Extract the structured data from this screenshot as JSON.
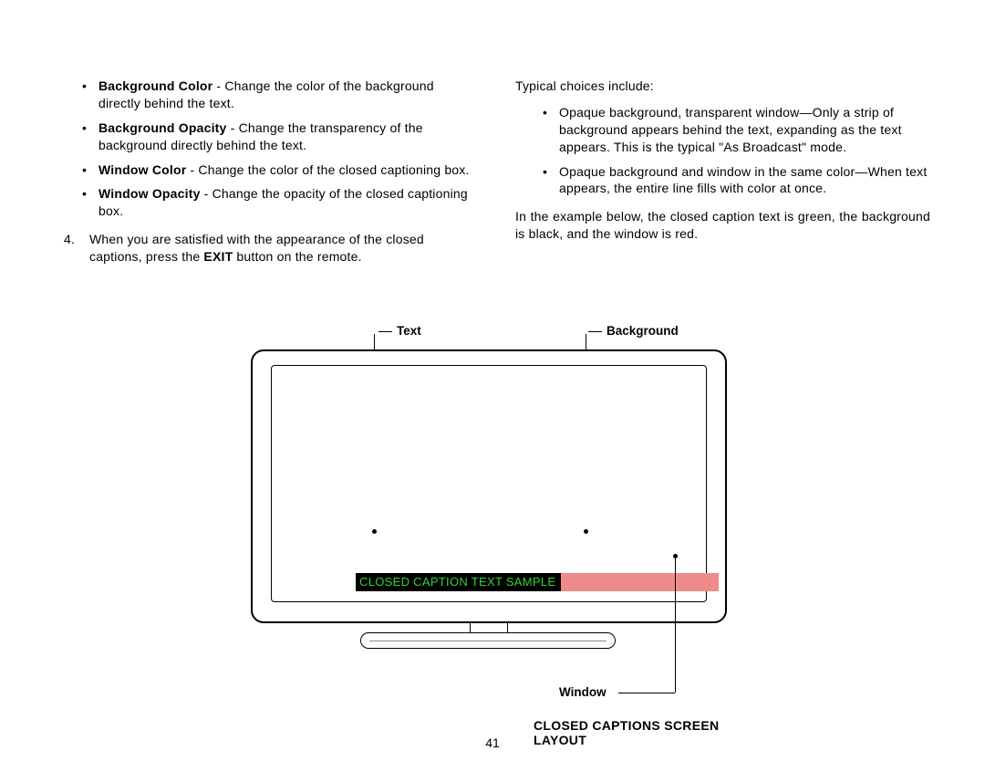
{
  "left": {
    "bullets": [
      {
        "bold": "Background Color",
        "rest": " - Change the color of the background directly behind the text."
      },
      {
        "bold": "Background Opacity",
        "rest": " - Change the transparency of the background directly behind the text."
      },
      {
        "bold": "Window Color",
        "rest": " - Change the color of the closed captioning box."
      },
      {
        "bold": "Window Opacity",
        "rest": " - Change the opacity of the closed captioning box."
      }
    ],
    "step_num": "4.",
    "step_text_a": "When you are satisfied with the appearance of the closed captions, press the ",
    "step_bold": "EXIT",
    "step_text_b": " button on the remote."
  },
  "right": {
    "intro": "Typical choices include:",
    "bullets": [
      "Opaque background, transparent window—Only a strip of background appears behind the text, expanding as the text appears. This is the typical \"As Broadcast\" mode.",
      "Opaque background and window in the same color—When text appears, the entire line fills with color at once."
    ],
    "example": "In the example below, the closed caption text is green, the background is black, and the window is red."
  },
  "diagram": {
    "label_text": "Text",
    "label_background": "Background",
    "label_window": "Window",
    "caption_sample": "CLOSED CAPTION TEXT SAMPLE",
    "title": "CLOSED CAPTIONS SCREEN LAYOUT"
  },
  "page_number": "41"
}
